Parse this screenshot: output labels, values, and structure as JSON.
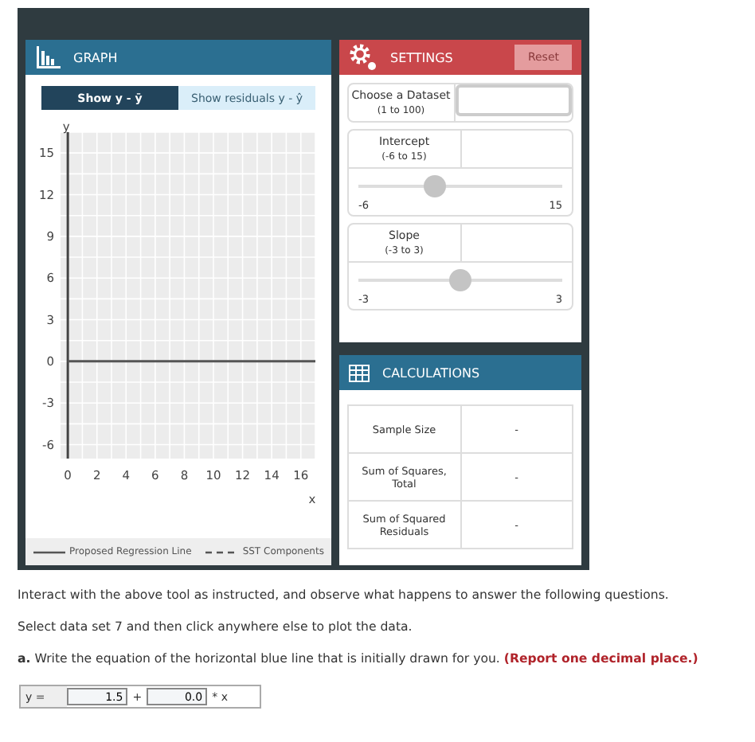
{
  "graph": {
    "title": "GRAPH",
    "toggle": [
      {
        "label": "Show y - ȳ",
        "selected": true
      },
      {
        "label": "Show residuals y - ŷ",
        "selected": false
      }
    ],
    "chart_data": {
      "type": "line",
      "xlabel": "x",
      "ylabel": "y",
      "x": [
        0,
        17
      ],
      "series": [
        {
          "name": "Proposed Regression Line",
          "color": "#555555",
          "values": [
            0,
            0
          ]
        }
      ],
      "xlim": [
        -0.5,
        17
      ],
      "ylim": [
        -7,
        16.5
      ],
      "grid": true,
      "xticks": [
        0,
        2,
        4,
        6,
        8,
        10,
        12,
        14,
        16
      ],
      "yticks": [
        -6,
        -3,
        0,
        3,
        6,
        9,
        12,
        15
      ]
    },
    "legend": [
      {
        "label": "SST Components",
        "kind": "dashed"
      }
    ]
  },
  "settings": {
    "title": "SETTINGS",
    "reset": "Reset",
    "dataset": {
      "label": "Choose a Dataset",
      "range": "(1 to 100)"
    },
    "sliders": [
      {
        "label": "Intercept",
        "range": "(-6 to 15)",
        "min": "-6",
        "max": "15",
        "level": 0.357
      },
      {
        "label": "Slope",
        "range": "(-3 to 3)",
        "min": "-3",
        "max": "3",
        "level": 0.5
      }
    ]
  },
  "calculations": {
    "title": "CALCULATIONS",
    "rows": [
      {
        "label": "Sample Size",
        "value": "-"
      },
      {
        "label": "Sum of Squares, Total",
        "value": "-"
      },
      {
        "label": "Sum of Squared Residuals",
        "value": "-"
      }
    ]
  },
  "instructions": [
    "Interact with the above tool as instructed, and observe what happens to answer the following questions.",
    "Select data set 7 and then click anywhere else to plot the data."
  ],
  "question": {
    "number": "a.",
    "text": "Write the equation of the horizontal blue line that is initially drawn for you.",
    "note": "(Report one decimal place.)"
  },
  "answer": {
    "prefix": "y =",
    "intercept": "1.5",
    "plus": "+",
    "slope": "0.0",
    "suffix": "* x"
  }
}
